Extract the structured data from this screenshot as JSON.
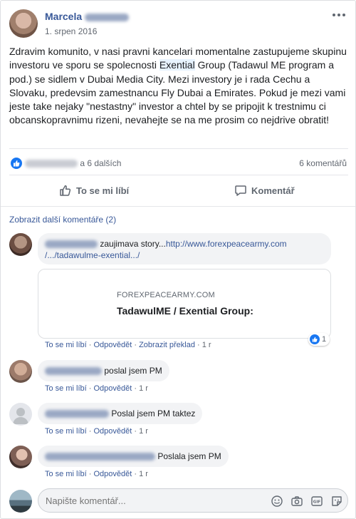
{
  "post": {
    "author_first": "Marcela",
    "date": "1. srpen 2016",
    "text_1": "Zdravim komunito, v nasi pravni kancelari momentalne zastupujeme skupinu investoru ve sporu se spolecnosti ",
    "text_highlight": "Exential",
    "text_2": " Group (Tadawul ME program a pod.) se sidlem v Dubai Media City. Mezi investory je i rada Cechu a Slovaku, predevsim zamestnancu Fly Dubai a Emirates. Pokud je mezi vami jeste take nejaky \"nestastny\" investor a chtel by se pripojit k trestnimu ci obcanskopravnimu rizeni, nevahejte se na me prosim co nejdrive obratit!",
    "reactions_suffix": "a 6 dalších",
    "comment_count": "6 komentářů"
  },
  "actions": {
    "like": "To se mi líbí",
    "comment": "Komentář"
  },
  "comments_header": "Zobrazit další komentáře (2)",
  "comments": [
    {
      "text": "zaujimava story...",
      "link_1": "http://www.forexpeacearmy.com",
      "link_2": "/.../tadawulme-exential.../",
      "preview_domain": "FOREXPEACEARMY.COM",
      "preview_title": "TadawulME / Exential Group:",
      "reaction_count": "1",
      "like": "To se mi líbí",
      "reply": "Odpovědět",
      "translate": "Zobrazit překlad",
      "time": "1 r"
    },
    {
      "text": "poslal jsem PM",
      "like": "To se mi líbí",
      "reply": "Odpovědět",
      "time": "1 r"
    },
    {
      "text": "Poslal jsem PM taktez",
      "like": "To se mi líbí",
      "reply": "Odpovědět",
      "time": "1 r"
    },
    {
      "text": "Poslala jsem PM",
      "like": "To se mi líbí",
      "reply": "Odpovědět",
      "time": "1 r"
    }
  ],
  "composer": {
    "placeholder": "Napište komentář..."
  },
  "icons": {
    "like": "thumbs-up-icon",
    "comment": "speech-bubble-icon",
    "more": "more-dots-icon",
    "emoji": "emoji-icon",
    "camera": "camera-icon",
    "gif": "gif-icon",
    "sticker": "sticker-icon"
  },
  "colors": {
    "link": "#385898",
    "like_blue": "#1877f2",
    "bubble": "#f2f3f5",
    "meta": "#616770"
  }
}
